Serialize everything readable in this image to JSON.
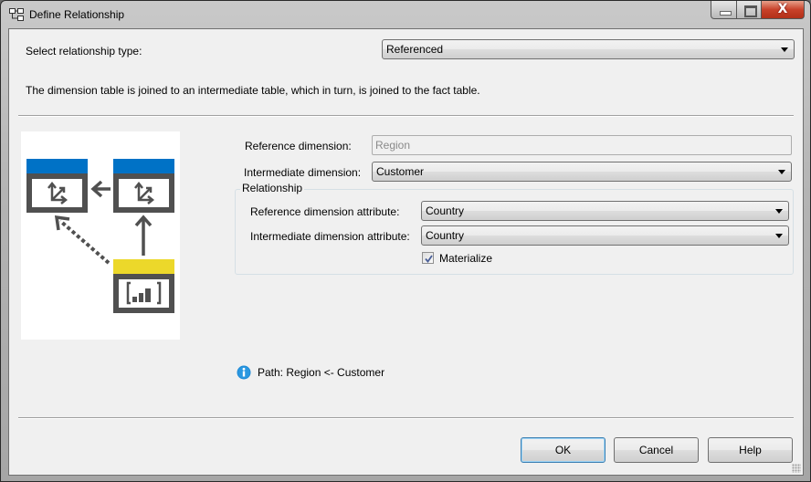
{
  "window": {
    "title": "Define Relationship",
    "icon": "relationship-tree-icon",
    "controls": {
      "minimize": "minimize-icon",
      "maximize": "maximize-icon",
      "close": "close-icon",
      "close_glyph": "X"
    }
  },
  "relationship_type": {
    "label": "Select relationship type:",
    "selected": "Referenced"
  },
  "description": "The dimension table is joined to an intermediate table, which in turn, is joined to the fact table.",
  "diagram": {
    "description": "Referenced relationship diagram: fact table (yellow) joined to intermediate dimension (blue), which is joined to reference dimension (blue); dotted arrow from fact to reference dimension",
    "colors": {
      "dimension_header": "#0072c6",
      "fact_header": "#ecd82a",
      "frame": "#505050"
    }
  },
  "fields": {
    "reference_dimension": {
      "label": "Reference dimension:",
      "value": "Region"
    },
    "intermediate_dimension": {
      "label": "Intermediate dimension:",
      "selected": "Customer"
    }
  },
  "relationship_group": {
    "title": "Relationship",
    "reference_attribute": {
      "label": "Reference dimension attribute:",
      "selected": "Country"
    },
    "intermediate_attribute": {
      "label": "Intermediate dimension attribute:",
      "selected": "Country"
    },
    "materialize": {
      "label": "Materialize",
      "checked": true
    }
  },
  "info": {
    "icon": "info-icon",
    "text": "Path: Region <- Customer"
  },
  "buttons": {
    "ok": "OK",
    "cancel": "Cancel",
    "help": "Help"
  }
}
